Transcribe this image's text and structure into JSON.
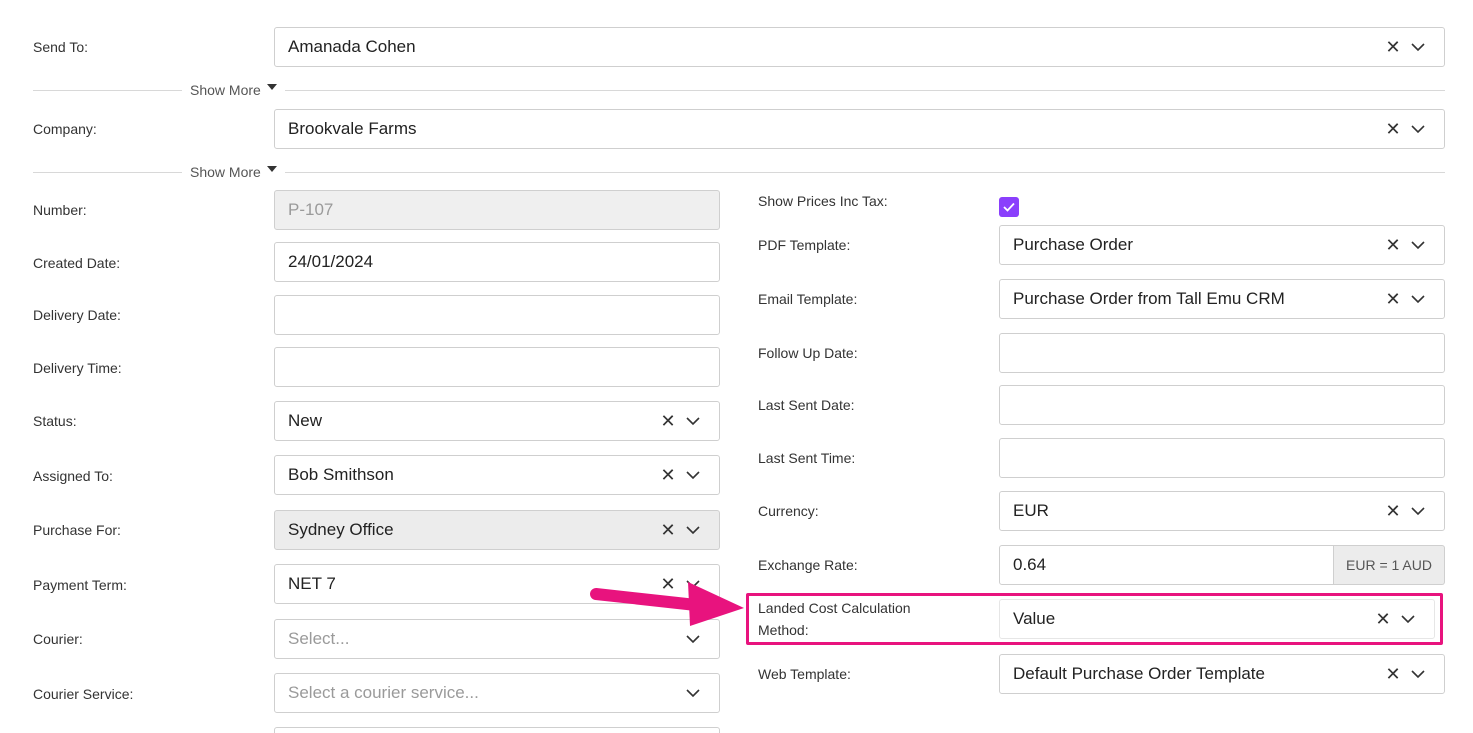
{
  "form": {
    "send_to": {
      "label": "Send To:",
      "value": "Amanada Cohen"
    },
    "show_more_1": "Show More",
    "company": {
      "label": "Company:",
      "value": "Brookvale Farms"
    },
    "show_more_2": "Show More",
    "left": {
      "number": {
        "label": "Number:",
        "value": "P-107"
      },
      "created_date": {
        "label": "Created Date:",
        "value": "24/01/2024"
      },
      "delivery_date": {
        "label": "Delivery Date:",
        "value": ""
      },
      "delivery_time": {
        "label": "Delivery Time:",
        "value": ""
      },
      "status": {
        "label": "Status:",
        "value": "New"
      },
      "assigned_to": {
        "label": "Assigned To:",
        "value": "Bob Smithson"
      },
      "purchase_for": {
        "label": "Purchase For:",
        "value": "Sydney Office"
      },
      "payment_term": {
        "label": "Payment Term:",
        "value": "NET 7"
      },
      "courier": {
        "label": "Courier:",
        "placeholder": "Select..."
      },
      "courier_service": {
        "label": "Courier Service:",
        "placeholder": "Select a courier service..."
      }
    },
    "right": {
      "show_prices_inc_tax": {
        "label": "Show Prices Inc Tax:",
        "checked": true
      },
      "pdf_template": {
        "label": "PDF Template:",
        "value": "Purchase Order"
      },
      "email_template": {
        "label": "Email Template:",
        "value": "Purchase Order from Tall Emu CRM"
      },
      "follow_up_date": {
        "label": "Follow Up Date:",
        "value": ""
      },
      "last_sent_date": {
        "label": "Last Sent Date:",
        "value": ""
      },
      "last_sent_time": {
        "label": "Last Sent Time:",
        "value": ""
      },
      "currency": {
        "label": "Currency:",
        "value": "EUR"
      },
      "exchange_rate": {
        "label": "Exchange Rate:",
        "value": "0.64",
        "addon": "EUR = 1 AUD"
      },
      "landed_cost": {
        "label_line1": "Landed Cost Calculation",
        "label_line2": "Method:",
        "value": "Value"
      },
      "web_template": {
        "label": "Web Template:",
        "value": "Default Purchase Order Template"
      }
    }
  },
  "colors": {
    "accent": "#8a3ffc",
    "highlight": "#e8137e"
  },
  "icons": {
    "clear": "close-icon",
    "dropdown": "chevron-down-icon",
    "check": "check-icon",
    "arrow": "arrow-right-icon"
  }
}
